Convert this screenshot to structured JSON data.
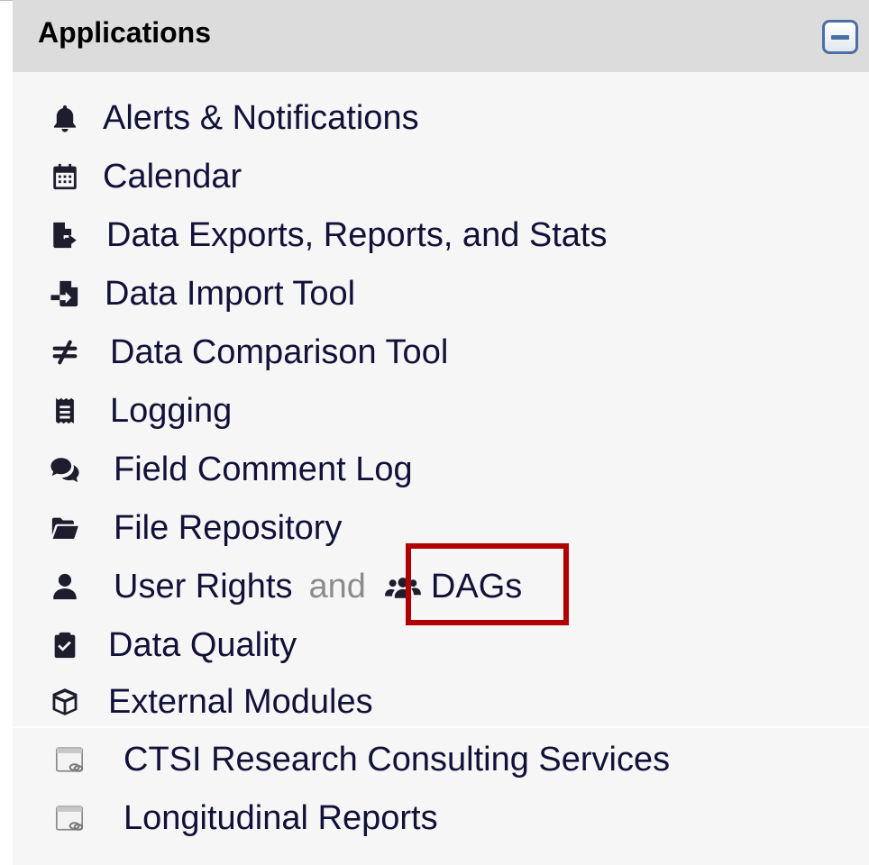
{
  "header": {
    "title": "Applications"
  },
  "items": [
    {
      "label": "Alerts & Notifications",
      "icon": "bell-icon"
    },
    {
      "label": "Calendar",
      "icon": "calendar-icon"
    },
    {
      "label": "Data Exports, Reports, and Stats",
      "icon": "file-export-icon"
    },
    {
      "label": "Data Import Tool",
      "icon": "file-import-icon"
    },
    {
      "label": "Data Comparison Tool",
      "icon": "not-equal-icon"
    },
    {
      "label": "Logging",
      "icon": "receipt-icon"
    },
    {
      "label": "Field Comment Log",
      "icon": "comments-icon"
    },
    {
      "label": "File Repository",
      "icon": "folder-open-icon"
    },
    {
      "label": "User Rights",
      "icon": "user-icon"
    },
    {
      "label": "Data Quality",
      "icon": "clipboard-check-icon"
    },
    {
      "label": "External Modules",
      "icon": "cube-icon"
    }
  ],
  "user_rights_connector": "and",
  "dags": {
    "label": "DAGs",
    "icon": "users-icon"
  },
  "external_links": [
    {
      "label": "CTSI Research Consulting Services",
      "icon": "external-link-window-icon"
    },
    {
      "label": "Longitudinal Reports",
      "icon": "external-link-window-icon"
    }
  ],
  "colors": {
    "highlight": "#b00000",
    "link": "#111139",
    "header_bg": "#dcdcdc"
  }
}
